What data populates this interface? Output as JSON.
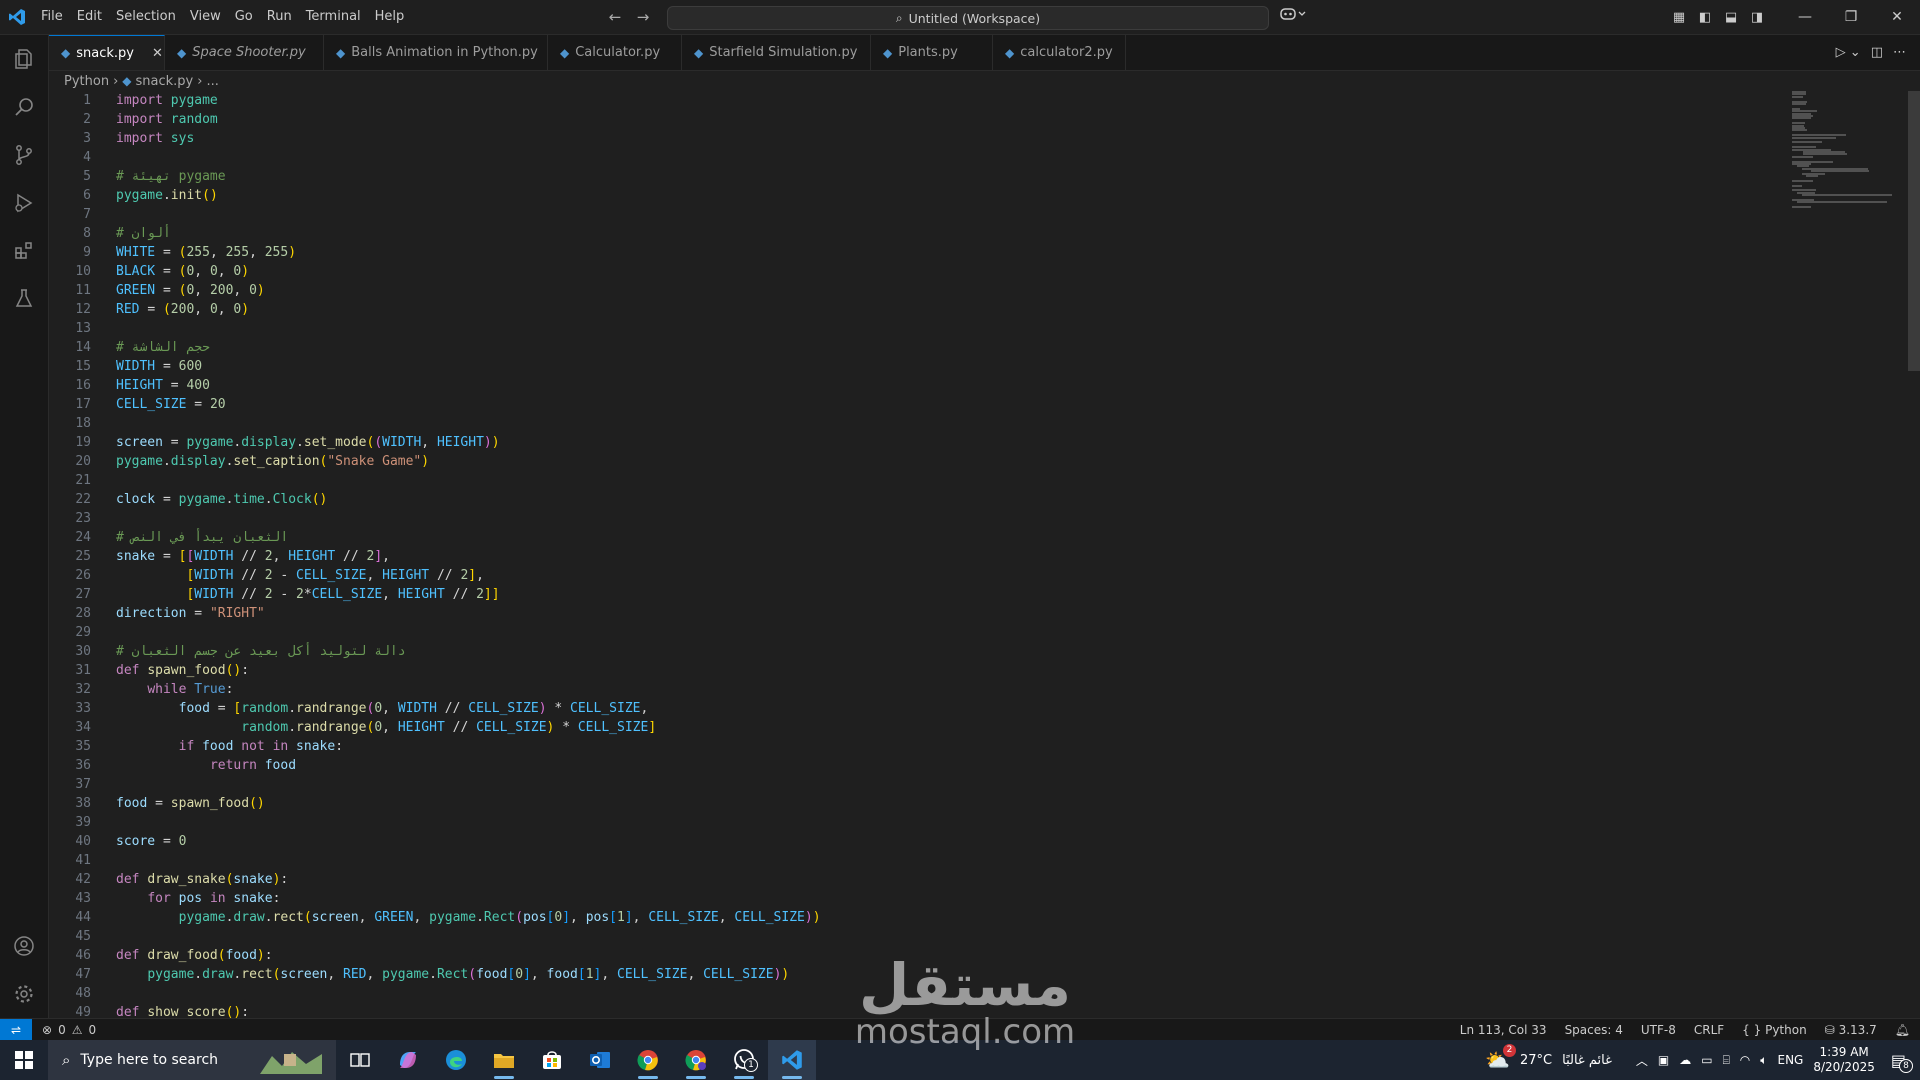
{
  "menu": [
    "File",
    "Edit",
    "Selection",
    "View",
    "Go",
    "Run",
    "Terminal",
    "Help"
  ],
  "command_center": "Untitled (Workspace)",
  "tabs": [
    {
      "label": "snack.py",
      "active": true,
      "italic": false
    },
    {
      "label": "Space Shooter.py",
      "active": false,
      "italic": true
    },
    {
      "label": "Balls Animation in Python.py",
      "active": false,
      "italic": false
    },
    {
      "label": "Calculator.py",
      "active": false,
      "italic": false
    },
    {
      "label": "Starfield Simulation.py",
      "active": false,
      "italic": false
    },
    {
      "label": "Plants.py",
      "active": false,
      "italic": false
    },
    {
      "label": "calculator2.py",
      "active": false,
      "italic": false
    }
  ],
  "breadcrumb": {
    "folder": "Python",
    "file": "snack.py",
    "more": "..."
  },
  "code_lines": [
    "import pygame",
    "import random",
    "import sys",
    "",
    "# تهيئة pygame",
    "pygame.init()",
    "",
    "# ألوان",
    "WHITE = (255, 255, 255)",
    "BLACK = (0, 0, 0)",
    "GREEN = (0, 200, 0)",
    "RED = (200, 0, 0)",
    "",
    "# حجم الشاشة",
    "WIDTH = 600",
    "HEIGHT = 400",
    "CELL_SIZE = 20",
    "",
    "screen = pygame.display.set_mode((WIDTH, HEIGHT))",
    "pygame.display.set_caption(\"Snake Game\")",
    "",
    "clock = pygame.time.Clock()",
    "",
    "# الثعبان يبدأ في النص",
    "snake = [[WIDTH // 2, HEIGHT // 2],",
    "         [WIDTH // 2 - CELL_SIZE, HEIGHT // 2],",
    "         [WIDTH // 2 - 2*CELL_SIZE, HEIGHT // 2]]",
    "direction = \"RIGHT\"",
    "",
    "# دالة لتوليد أكل بعيد عن جسم الثعبان",
    "def spawn_food():",
    "    while True:",
    "        food = [random.randrange(0, WIDTH // CELL_SIZE) * CELL_SIZE,",
    "                random.randrange(0, HEIGHT // CELL_SIZE) * CELL_SIZE]",
    "        if food not in snake:",
    "            return food",
    "",
    "food = spawn_food()",
    "",
    "score = 0",
    "",
    "def draw_snake(snake):",
    "    for pos in snake:",
    "        pygame.draw.rect(screen, GREEN, pygame.Rect(pos[0], pos[1], CELL_SIZE, CELL_SIZE))",
    "",
    "def draw_food(food):",
    "    pygame.draw.rect(screen, RED, pygame.Rect(food[0], food[1], CELL_SIZE, CELL_SIZE))",
    "",
    "def show_score():"
  ],
  "status": {
    "errors": "0",
    "warnings": "0",
    "position": "Ln 113, Col 33",
    "spaces": "Spaces: 4",
    "encoding": "UTF-8",
    "eol": "CRLF",
    "language": "Python",
    "version": "3.13.7"
  },
  "taskbar": {
    "search_placeholder": "Type here to search",
    "weather_temp": "27°C",
    "weather_text": "غائم غالبًا",
    "weather_badge": "2",
    "lang": "ENG",
    "time": "1:39 AM",
    "date": "8/20/2025",
    "notif_count": "8",
    "whatsapp_badge": "1"
  },
  "watermark": {
    "arabic": "مستقل",
    "latin": "mostaql.com"
  },
  "colors": {
    "accent": "#0078d4",
    "editor_bg": "#1f1f1f",
    "activity_bg": "#181818"
  }
}
